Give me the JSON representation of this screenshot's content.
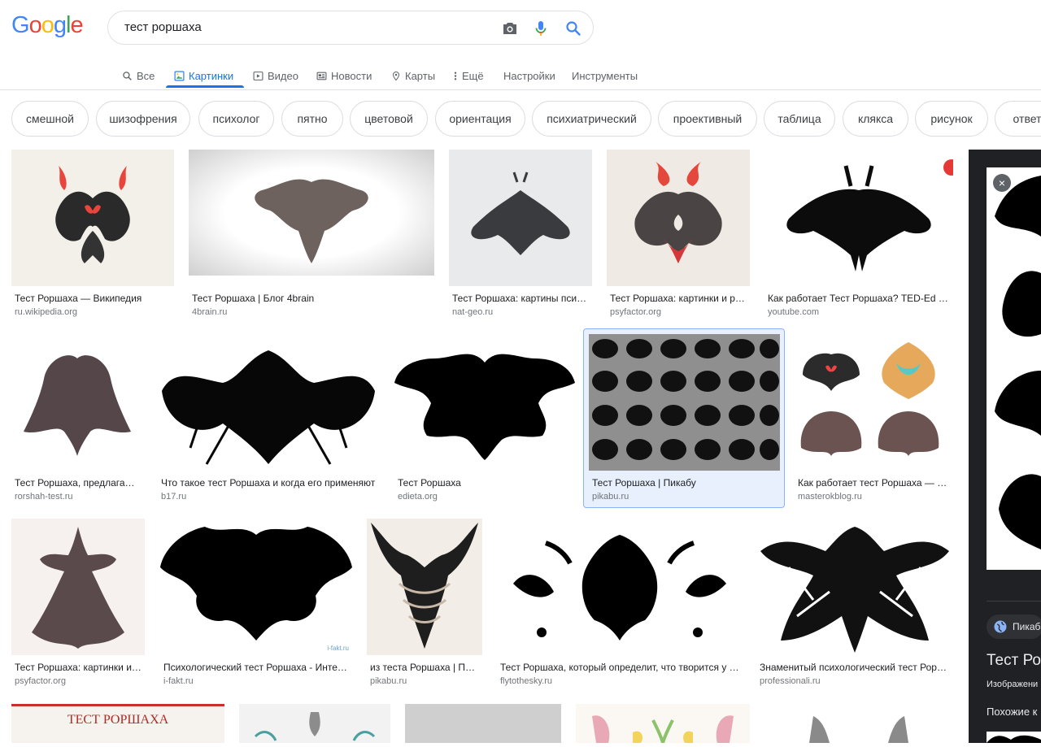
{
  "logo": {
    "g1": "G",
    "o1": "o",
    "o2": "o",
    "g2": "g",
    "l": "l",
    "e": "e"
  },
  "search": {
    "query": "тест роршаха"
  },
  "tabs": [
    {
      "label": "Все",
      "icon": "search-icon"
    },
    {
      "label": "Картинки",
      "icon": "image-icon"
    },
    {
      "label": "Видео",
      "icon": "video-icon"
    },
    {
      "label": "Новости",
      "icon": "news-icon"
    },
    {
      "label": "Карты",
      "icon": "map-pin-icon"
    },
    {
      "label": "Ещё",
      "icon": "more-vert-icon"
    },
    {
      "label": "Настройки"
    },
    {
      "label": "Инструменты"
    }
  ],
  "chips": [
    "смешной",
    "шизофрения",
    "психолог",
    "пятно",
    "цветовой",
    "ориентация",
    "психиатрический",
    "проективный",
    "таблица",
    "клякса",
    "рисунок",
    "ответ"
  ],
  "results": [
    {
      "title": "Тест Роршаха — Википедия",
      "source": "ru.wikipedia.org"
    },
    {
      "title": "Тест Роршаха | Блог 4brain",
      "source": "4brain.ru"
    },
    {
      "title": "Тест Роршаха: картины псих...",
      "source": "nat-geo.ru"
    },
    {
      "title": "Тест Роршаха: картинки и ра...",
      "source": "psyfactor.org"
    },
    {
      "title": "Как работает Тест Роршаха? TED-Ed - Y...",
      "source": "youtube.com"
    },
    {
      "title": "Тест Роршаха, предлагаем...",
      "source": "rorshah-test.ru"
    },
    {
      "title": "Что такое тест Роршаха и когда его применяют",
      "source": "b17.ru"
    },
    {
      "title": "Тест Роршаха",
      "source": "edieta.org"
    },
    {
      "title": "Тест Роршаха | Пикабу",
      "source": "pikabu.ru"
    },
    {
      "title": "Как работает тест Роршаха — ХО...",
      "source": "masterokblog.ru"
    },
    {
      "title": "Тест Роршаха: картинки и ...",
      "source": "psyfactor.org"
    },
    {
      "title": "Психологический тест Роршаха - Интер...",
      "source": "i-fakt.ru"
    },
    {
      "title": "из теста Роршаха | Пик...",
      "source": "pikabu.ru"
    },
    {
      "title": "Тест Роршаха, который определит, что творится у в...",
      "source": "flytothesky.ru"
    },
    {
      "title": "Знаменитый психологический тест Рорш...",
      "source": "professionali.ru"
    }
  ],
  "row4_banner": "ТЕСТ РОРШАХА",
  "watermark": "i-fakt.ru",
  "panel": {
    "badge": "Пикаб",
    "title": "Тест Рор",
    "subtitle": "Изображени",
    "similar": "Похожие к"
  }
}
